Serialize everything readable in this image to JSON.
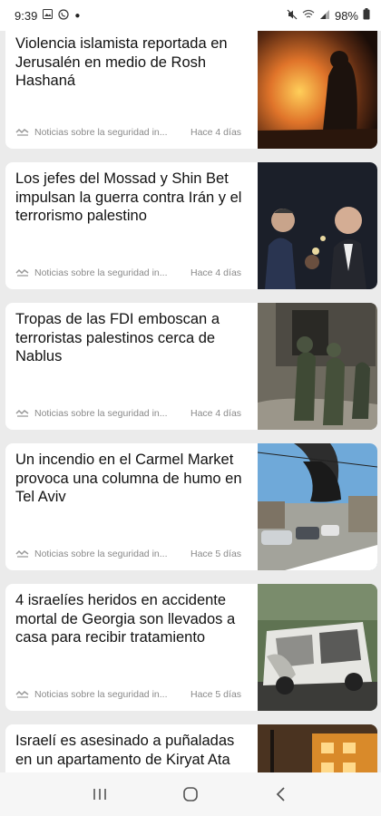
{
  "status_bar": {
    "time": "9:39",
    "battery": "98%",
    "notification_icons": [
      "gallery-icon",
      "whatsapp-icon",
      "dot-icon"
    ],
    "system_icons": [
      "mute-icon",
      "wifi-icon",
      "signal-icon",
      "battery-icon"
    ]
  },
  "feed": {
    "articles": [
      {
        "title": "Violencia islamista reportada en Jerusalén en medio de Rosh Hashaná",
        "source": "Noticias sobre la seguridad in...",
        "time": "Hace 4 días"
      },
      {
        "title": "Los jefes del Mossad y Shin Bet impulsan la guerra contra Irán y el terrorismo palestino",
        "source": "Noticias sobre la seguridad in...",
        "time": "Hace 4 días"
      },
      {
        "title": "Tropas de las FDI emboscan a terroristas palestinos cerca de Nablus",
        "source": "Noticias sobre la seguridad in...",
        "time": "Hace 4 días"
      },
      {
        "title": "Un incendio en el Carmel Market provoca una columna de humo en Tel Aviv",
        "source": "Noticias sobre la seguridad in...",
        "time": "Hace 5 días"
      },
      {
        "title": "4 israelíes heridos en accidente mortal de Georgia son llevados a casa para recibir tratamiento",
        "source": "Noticias sobre la seguridad in...",
        "time": "Hace 5 días"
      },
      {
        "title": "Israelí es asesinado a puñaladas en un apartamento de Kiryat Ata",
        "source": "",
        "time": ""
      }
    ]
  },
  "nav_bar": {
    "buttons": [
      "recent-apps-icon",
      "home-icon",
      "back-icon"
    ]
  }
}
